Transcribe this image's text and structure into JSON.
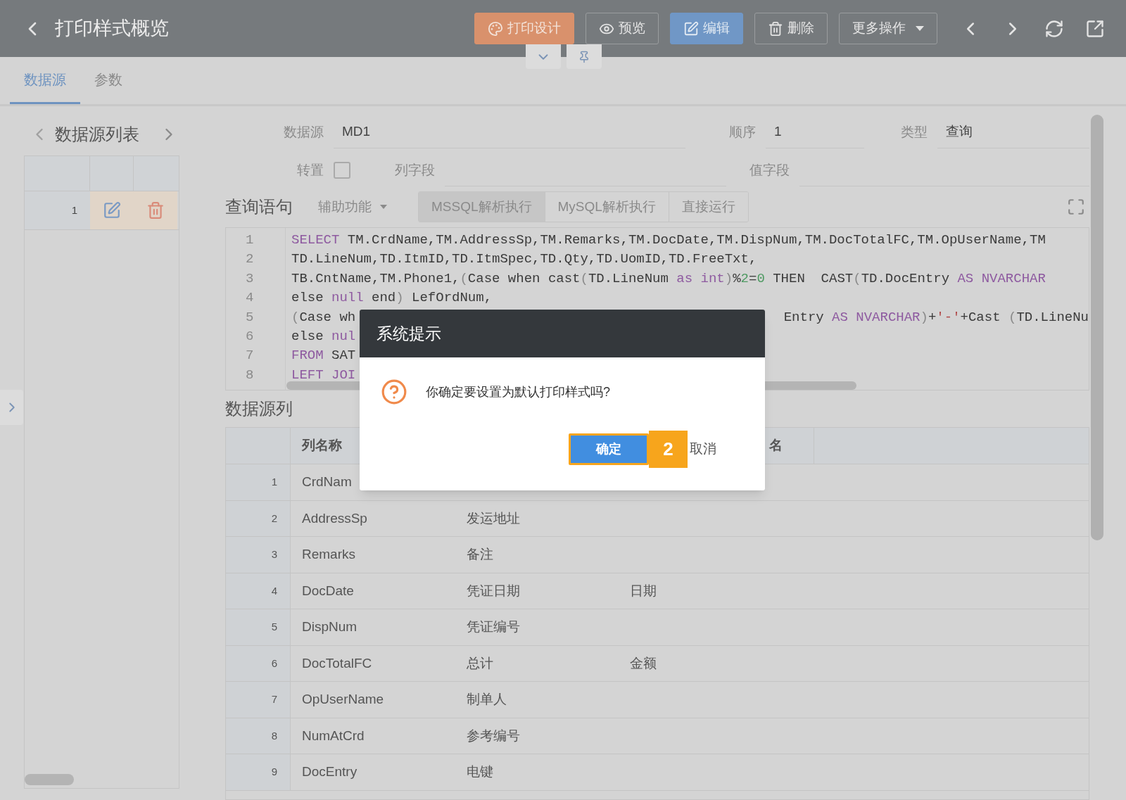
{
  "header": {
    "title": "打印样式概览",
    "buttons": [
      {
        "label": "打印设计",
        "kind": "design"
      },
      {
        "label": "预览",
        "kind": "preview"
      },
      {
        "label": "编辑",
        "kind": "edit"
      },
      {
        "label": "删除",
        "kind": "delete"
      },
      {
        "label": "更多操作",
        "kind": "more"
      }
    ]
  },
  "tabs": [
    {
      "label": "数据源",
      "selected": true
    },
    {
      "label": "参数",
      "selected": false
    }
  ],
  "left_panel": {
    "title": "数据源列表",
    "rows": [
      {
        "number": "1"
      }
    ]
  },
  "form": {
    "source_label": "数据源",
    "source_value": "MD1",
    "order_label": "顺序",
    "order_value": "1",
    "type_label": "类型",
    "type_value": "查询",
    "transpose_label": "转置",
    "transpose_checked": false,
    "column_field_label": "列字段",
    "value_field_label": "值字段"
  },
  "query": {
    "title": "查询语句",
    "helper": "辅助功能",
    "run_buttons": [
      "MSSQL解析执行",
      "MySQL解析执行",
      "直接运行"
    ]
  },
  "code": [
    {
      "number": "1",
      "left": [
        {
          "t": "SELECT",
          "kind": "keyword"
        },
        {
          "t": " TM.CrdName,TM.AddressSp,TM.Remarks,TM.DocDate,TM.DispNum,TM.DocTotalFC,TM.OpUserName,TM",
          "kind": "plain"
        }
      ]
    },
    {
      "number": "2",
      "left": [
        {
          "t": "TD.LineNum,TD.ItmID,TD.ItmSpec,TD.Qty,TD.UomID,TD.FreeTxt,",
          "kind": "plain"
        }
      ]
    },
    {
      "number": "3",
      "left": [
        {
          "t": "TB.CntName,TM.Phone1,",
          "kind": "plain"
        },
        {
          "t": "(",
          "kind": "paren"
        },
        {
          "t": "Case when cast",
          "kind": "plain"
        },
        {
          "t": "(",
          "kind": "paren"
        },
        {
          "t": "TD.LineNum",
          "kind": "plain"
        },
        {
          "t": " as int",
          "kind": "keyword"
        },
        {
          "t": ")",
          "kind": "paren"
        },
        {
          "t": "%",
          "kind": "plain"
        },
        {
          "t": "2",
          "kind": "number"
        },
        {
          "t": "=",
          "kind": "plain"
        },
        {
          "t": "0",
          "kind": "number"
        },
        {
          "t": " THEN  CAST",
          "kind": "plain"
        },
        {
          "t": "(",
          "kind": "paren"
        },
        {
          "t": "TD.DocEntry",
          "kind": "plain"
        },
        {
          "t": " AS NVARCHAR",
          "kind": "keyword"
        }
      ]
    },
    {
      "number": "4",
      "left": [
        {
          "t": "else",
          "kind": "plain"
        },
        {
          "t": " null",
          "kind": "keyword"
        },
        {
          "t": " end",
          "kind": "plain"
        },
        {
          "t": ")",
          "kind": "paren"
        },
        {
          "t": " LefOrdNum,",
          "kind": "plain"
        }
      ]
    },
    {
      "number": "5",
      "left": [
        {
          "t": "(",
          "kind": "paren"
        },
        {
          "t": "Case wh",
          "kind": "plain"
        }
      ],
      "right": [
        {
          "t": "Entry",
          "kind": "plain"
        },
        {
          "t": " AS NVARCHAR",
          "kind": "keyword"
        },
        {
          "t": ")",
          "kind": "paren"
        },
        {
          "t": "+",
          "kind": "plain"
        },
        {
          "t": "'-'",
          "kind": "string"
        },
        {
          "t": "+Cast ",
          "kind": "plain"
        },
        {
          "t": "(",
          "kind": "paren"
        },
        {
          "t": "TD.LineNu",
          "kind": "plain"
        }
      ]
    },
    {
      "number": "6",
      "left": [
        {
          "t": "else",
          "kind": "plain"
        },
        {
          "t": " nul",
          "kind": "keyword"
        }
      ]
    },
    {
      "number": "7",
      "left": [
        {
          "t": "FROM",
          "kind": "keyword"
        },
        {
          "t": " SAT",
          "kind": "plain"
        }
      ]
    },
    {
      "number": "8",
      "left": [
        {
          "t": "LEFT JOI",
          "kind": "keyword"
        }
      ]
    }
  ],
  "columns_section": {
    "title": "数据源列",
    "columns": [
      "列名称",
      "名"
    ],
    "rows": [
      {
        "number": "1",
        "name": "CrdNam"
      },
      {
        "number": "2",
        "name": "AddressSp",
        "caption": "发运地址"
      },
      {
        "number": "3",
        "name": "Remarks",
        "caption": "备注"
      },
      {
        "number": "4",
        "name": "DocDate",
        "caption": "凭证日期",
        "column_4": "日期"
      },
      {
        "number": "5",
        "name": "DispNum",
        "caption": "凭证编号"
      },
      {
        "number": "6",
        "name": "DocTotalFC",
        "caption": "总计",
        "column_4": "金额"
      },
      {
        "number": "7",
        "name": "OpUserName",
        "caption": "制单人"
      },
      {
        "number": "8",
        "name": "NumAtCrd",
        "caption": "参考编号"
      },
      {
        "number": "9",
        "name": "DocEntry",
        "caption": "电键"
      }
    ]
  },
  "dialog": {
    "title": "系统提示",
    "message": "你确定要设置为默认打印样式吗?",
    "confirm": "确定",
    "step_badge": "2",
    "cancel": "取消"
  }
}
